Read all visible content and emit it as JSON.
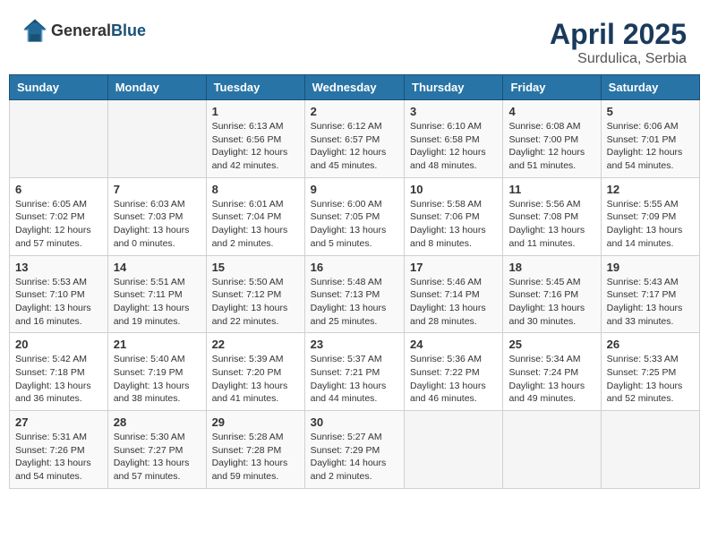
{
  "header": {
    "logo_general": "General",
    "logo_blue": "Blue",
    "month": "April 2025",
    "location": "Surdulica, Serbia"
  },
  "days_of_week": [
    "Sunday",
    "Monday",
    "Tuesday",
    "Wednesday",
    "Thursday",
    "Friday",
    "Saturday"
  ],
  "weeks": [
    [
      {
        "day": "",
        "info": ""
      },
      {
        "day": "",
        "info": ""
      },
      {
        "day": "1",
        "info": "Sunrise: 6:13 AM\nSunset: 6:56 PM\nDaylight: 12 hours and 42 minutes."
      },
      {
        "day": "2",
        "info": "Sunrise: 6:12 AM\nSunset: 6:57 PM\nDaylight: 12 hours and 45 minutes."
      },
      {
        "day": "3",
        "info": "Sunrise: 6:10 AM\nSunset: 6:58 PM\nDaylight: 12 hours and 48 minutes."
      },
      {
        "day": "4",
        "info": "Sunrise: 6:08 AM\nSunset: 7:00 PM\nDaylight: 12 hours and 51 minutes."
      },
      {
        "day": "5",
        "info": "Sunrise: 6:06 AM\nSunset: 7:01 PM\nDaylight: 12 hours and 54 minutes."
      }
    ],
    [
      {
        "day": "6",
        "info": "Sunrise: 6:05 AM\nSunset: 7:02 PM\nDaylight: 12 hours and 57 minutes."
      },
      {
        "day": "7",
        "info": "Sunrise: 6:03 AM\nSunset: 7:03 PM\nDaylight: 13 hours and 0 minutes."
      },
      {
        "day": "8",
        "info": "Sunrise: 6:01 AM\nSunset: 7:04 PM\nDaylight: 13 hours and 2 minutes."
      },
      {
        "day": "9",
        "info": "Sunrise: 6:00 AM\nSunset: 7:05 PM\nDaylight: 13 hours and 5 minutes."
      },
      {
        "day": "10",
        "info": "Sunrise: 5:58 AM\nSunset: 7:06 PM\nDaylight: 13 hours and 8 minutes."
      },
      {
        "day": "11",
        "info": "Sunrise: 5:56 AM\nSunset: 7:08 PM\nDaylight: 13 hours and 11 minutes."
      },
      {
        "day": "12",
        "info": "Sunrise: 5:55 AM\nSunset: 7:09 PM\nDaylight: 13 hours and 14 minutes."
      }
    ],
    [
      {
        "day": "13",
        "info": "Sunrise: 5:53 AM\nSunset: 7:10 PM\nDaylight: 13 hours and 16 minutes."
      },
      {
        "day": "14",
        "info": "Sunrise: 5:51 AM\nSunset: 7:11 PM\nDaylight: 13 hours and 19 minutes."
      },
      {
        "day": "15",
        "info": "Sunrise: 5:50 AM\nSunset: 7:12 PM\nDaylight: 13 hours and 22 minutes."
      },
      {
        "day": "16",
        "info": "Sunrise: 5:48 AM\nSunset: 7:13 PM\nDaylight: 13 hours and 25 minutes."
      },
      {
        "day": "17",
        "info": "Sunrise: 5:46 AM\nSunset: 7:14 PM\nDaylight: 13 hours and 28 minutes."
      },
      {
        "day": "18",
        "info": "Sunrise: 5:45 AM\nSunset: 7:16 PM\nDaylight: 13 hours and 30 minutes."
      },
      {
        "day": "19",
        "info": "Sunrise: 5:43 AM\nSunset: 7:17 PM\nDaylight: 13 hours and 33 minutes."
      }
    ],
    [
      {
        "day": "20",
        "info": "Sunrise: 5:42 AM\nSunset: 7:18 PM\nDaylight: 13 hours and 36 minutes."
      },
      {
        "day": "21",
        "info": "Sunrise: 5:40 AM\nSunset: 7:19 PM\nDaylight: 13 hours and 38 minutes."
      },
      {
        "day": "22",
        "info": "Sunrise: 5:39 AM\nSunset: 7:20 PM\nDaylight: 13 hours and 41 minutes."
      },
      {
        "day": "23",
        "info": "Sunrise: 5:37 AM\nSunset: 7:21 PM\nDaylight: 13 hours and 44 minutes."
      },
      {
        "day": "24",
        "info": "Sunrise: 5:36 AM\nSunset: 7:22 PM\nDaylight: 13 hours and 46 minutes."
      },
      {
        "day": "25",
        "info": "Sunrise: 5:34 AM\nSunset: 7:24 PM\nDaylight: 13 hours and 49 minutes."
      },
      {
        "day": "26",
        "info": "Sunrise: 5:33 AM\nSunset: 7:25 PM\nDaylight: 13 hours and 52 minutes."
      }
    ],
    [
      {
        "day": "27",
        "info": "Sunrise: 5:31 AM\nSunset: 7:26 PM\nDaylight: 13 hours and 54 minutes."
      },
      {
        "day": "28",
        "info": "Sunrise: 5:30 AM\nSunset: 7:27 PM\nDaylight: 13 hours and 57 minutes."
      },
      {
        "day": "29",
        "info": "Sunrise: 5:28 AM\nSunset: 7:28 PM\nDaylight: 13 hours and 59 minutes."
      },
      {
        "day": "30",
        "info": "Sunrise: 5:27 AM\nSunset: 7:29 PM\nDaylight: 14 hours and 2 minutes."
      },
      {
        "day": "",
        "info": ""
      },
      {
        "day": "",
        "info": ""
      },
      {
        "day": "",
        "info": ""
      }
    ]
  ]
}
